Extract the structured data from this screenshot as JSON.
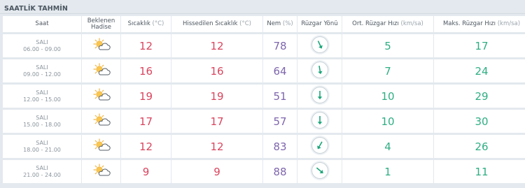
{
  "title": "SAATLİK TAHMİN",
  "headers": {
    "time": "Saat",
    "forecast_line1": "Beklenen",
    "forecast_line2": "Hadise",
    "temp": "Sıcaklık",
    "temp_unit": "(°C)",
    "feels": "Hissedilen Sıcaklık",
    "feels_unit": "(°C)",
    "humidity": "Nem",
    "humidity_unit": "(%)",
    "wind_dir": "Rüzgar Yönü",
    "avg_wind": "Ort. Rüzgar Hızı",
    "avg_wind_unit": "(km/sa)",
    "max_wind": "Maks. Rüzgar Hızı",
    "max_wind_unit": "(km/sa)"
  },
  "icon": "partly-cloudy-icon",
  "rows": [
    {
      "day": "SALI",
      "period": "06.00 - 09.00",
      "temp": "12",
      "feels": "12",
      "humidity": "78",
      "wind_deg": -25,
      "avg_wind": "5",
      "max_wind": "17"
    },
    {
      "day": "SALI",
      "period": "09.00 - 12.00",
      "temp": "16",
      "feels": "16",
      "humidity": "64",
      "wind_deg": -10,
      "avg_wind": "7",
      "max_wind": "24"
    },
    {
      "day": "SALI",
      "period": "12.00 - 15.00",
      "temp": "19",
      "feels": "19",
      "humidity": "51",
      "wind_deg": 0,
      "avg_wind": "10",
      "max_wind": "29"
    },
    {
      "day": "SALI",
      "period": "15.00 - 18.00",
      "temp": "17",
      "feels": "17",
      "humidity": "57",
      "wind_deg": 0,
      "avg_wind": "10",
      "max_wind": "30"
    },
    {
      "day": "SALI",
      "period": "18.00 - 21.00",
      "temp": "12",
      "feels": "12",
      "humidity": "83",
      "wind_deg": 30,
      "avg_wind": "4",
      "max_wind": "26"
    },
    {
      "day": "SALI",
      "period": "21.00 - 24.00",
      "temp": "9",
      "feels": "9",
      "humidity": "88",
      "wind_deg": -50,
      "avg_wind": "1",
      "max_wind": "11"
    }
  ],
  "colors": {
    "temp": "#d9455e",
    "humidity": "#7e66ad",
    "wind": "#2fae84",
    "arrow": "#1aa579"
  }
}
